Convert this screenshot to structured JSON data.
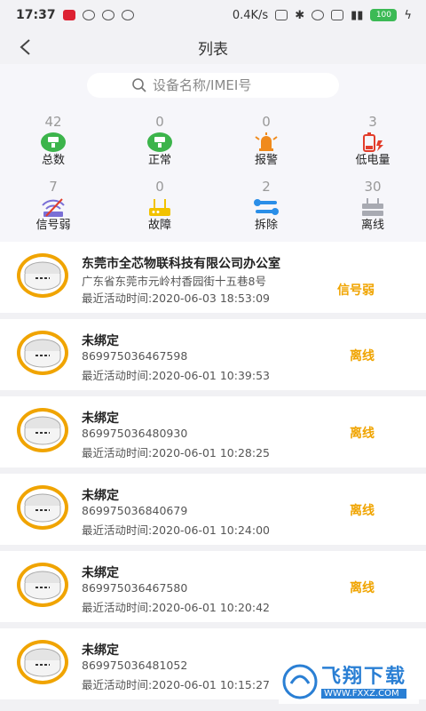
{
  "status_bar": {
    "time": "17:37",
    "network_speed": "0.4K/s",
    "battery": "100"
  },
  "nav": {
    "back_glyph": "<",
    "title": "列表"
  },
  "search": {
    "placeholder": "设备名称/IMEI号"
  },
  "stats": [
    {
      "count": "42",
      "label": "总数",
      "icon": "total-icon",
      "color": "#3cb44b"
    },
    {
      "count": "0",
      "label": "正常",
      "icon": "normal-icon",
      "color": "#3cb44b"
    },
    {
      "count": "0",
      "label": "报警",
      "icon": "alarm-bell-icon",
      "color": "#f08a1c"
    },
    {
      "count": "3",
      "label": "低电量",
      "icon": "low-battery-icon",
      "color": "#e23d2b"
    },
    {
      "count": "7",
      "label": "信号弱",
      "icon": "weak-signal-icon",
      "color": "#7a6fd6"
    },
    {
      "count": "0",
      "label": "故障",
      "icon": "fault-icon",
      "color": "#f2c200"
    },
    {
      "count": "2",
      "label": "拆除",
      "icon": "tools-icon",
      "color": "#2a8ee8"
    },
    {
      "count": "30",
      "label": "离线",
      "icon": "offline-icon",
      "color": "#a8aab2"
    }
  ],
  "devices": [
    {
      "name": "东莞市全芯物联科技有限公司办公室",
      "sub": "广东省东莞市元岭村香园街十五巷8号",
      "time": "最近活动时间:2020-06-03 18:53:09",
      "status": "信号弱"
    },
    {
      "name": "未绑定",
      "sub": "869975036467598",
      "time": "最近活动时间:2020-06-01 10:39:53",
      "status": "离线"
    },
    {
      "name": "未绑定",
      "sub": "869975036480930",
      "time": "最近活动时间:2020-06-01 10:28:25",
      "status": "离线"
    },
    {
      "name": "未绑定",
      "sub": "869975036840679",
      "time": "最近活动时间:2020-06-01 10:24:00",
      "status": "离线"
    },
    {
      "name": "未绑定",
      "sub": "869975036467580",
      "time": "最近活动时间:2020-06-01 10:20:42",
      "status": "离线"
    },
    {
      "name": "未绑定",
      "sub": "869975036481052",
      "time": "最近活动时间:2020-06-01 10:15:27",
      "status": ""
    }
  ],
  "watermark": {
    "big": "飞翔下载",
    "small": "WWW.FXXZ.COM"
  }
}
